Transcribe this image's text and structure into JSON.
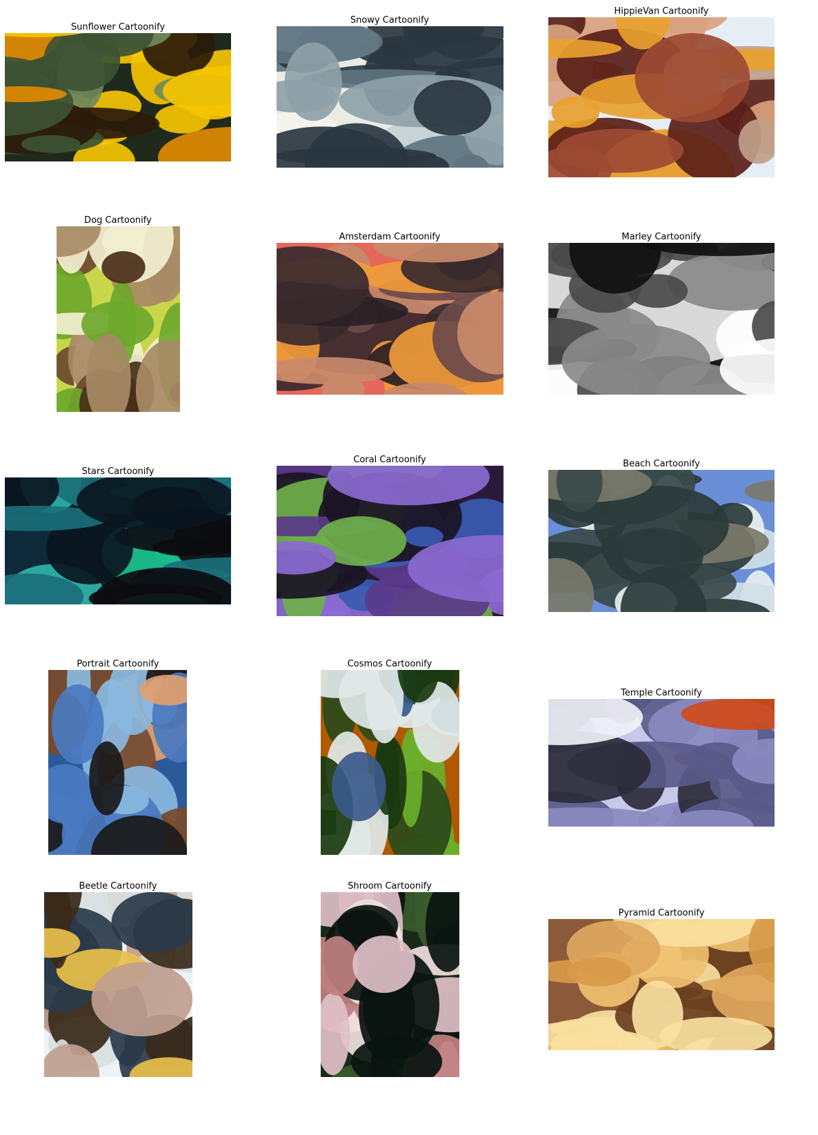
{
  "panels": [
    {
      "title": "Sunflower Cartoonify",
      "palette": [
        "#1f2a1c",
        "#3d5233",
        "#6f8a5c",
        "#f5c400",
        "#e08a00",
        "#2b1a0a"
      ]
    },
    {
      "title": "Snowy Cartoonify",
      "palette": [
        "#e9ece4",
        "#c3d0d4",
        "#5f7480",
        "#2a3640",
        "#f4f4ee",
        "#8ea1a8"
      ]
    },
    {
      "title": "HippieVan Cartoonify",
      "palette": [
        "#e6eef5",
        "#9c4b33",
        "#5a1f18",
        "#d9a27e",
        "#e8a12e",
        "#bfa08a"
      ]
    },
    {
      "title": "Dog Cartoonify",
      "palette": [
        "#c9d64a",
        "#6ea82c",
        "#6b4a2e",
        "#4a2f1a",
        "#a88a66",
        "#f2efd0"
      ]
    },
    {
      "title": "Amsterdam Cartoonify",
      "palette": [
        "#e4675a",
        "#f09a3a",
        "#3a2a2e",
        "#6b4a4a",
        "#2a1f24",
        "#c98a6a"
      ]
    },
    {
      "title": "Marley Cartoonify",
      "palette": [
        "#d9d9d9",
        "#8a8a8a",
        "#4a4a4a",
        "#2a2a2a",
        "#ffffff",
        "#101010"
      ]
    },
    {
      "title": "Stars Cartoonify",
      "palette": [
        "#0f2a3a",
        "#1a6f7a",
        "#2fb3a8",
        "#1ac28e",
        "#0a1620",
        "#0c0c10"
      ]
    },
    {
      "title": "Coral Cartoonify",
      "palette": [
        "#2a1a3a",
        "#5a3a8a",
        "#8a6ad0",
        "#6fb04a",
        "#3a5ab0",
        "#1a1424"
      ]
    },
    {
      "title": "Beach Cartoonify",
      "palette": [
        "#6a8ed8",
        "#3a4a4a",
        "#7a7a6a",
        "#cfe0e6",
        "#2a3a3a",
        "#e8f0f0"
      ]
    },
    {
      "title": "Portrait Cartoonify",
      "palette": [
        "#2a5a9a",
        "#4a7ac0",
        "#8ab8e0",
        "#e0a070",
        "#1a1a1a",
        "#7a4a2a"
      ]
    },
    {
      "title": "Cosmos Cartoonify",
      "palette": [
        "#b05a00",
        "#6ab02a",
        "#1a3a10",
        "#e0e8e8",
        "#3a5a8a",
        "#2a4a1a"
      ]
    },
    {
      "title": "Temple Cartoonify",
      "palette": [
        "#c8c8e8",
        "#8a8ac0",
        "#5a5a8a",
        "#d04a1a",
        "#f0f0f8",
        "#2a2a3a"
      ]
    },
    {
      "title": "Beetle Cartoonify",
      "palette": [
        "#eef2f4",
        "#3a2a1a",
        "#d8e0e0",
        "#e8c04a",
        "#c0a090",
        "#2a3a4a"
      ]
    },
    {
      "title": "Shroom Cartoonify",
      "palette": [
        "#1a2a1a",
        "#3a5a2a",
        "#e0c0c8",
        "#f0e0e0",
        "#c08080",
        "#0a1410"
      ]
    },
    {
      "title": "Pyramid Cartoonify",
      "palette": [
        "#8a5a3a",
        "#d89a4a",
        "#f0c070",
        "#6a4020",
        "#e0a860",
        "#f8e0a0"
      ]
    }
  ]
}
